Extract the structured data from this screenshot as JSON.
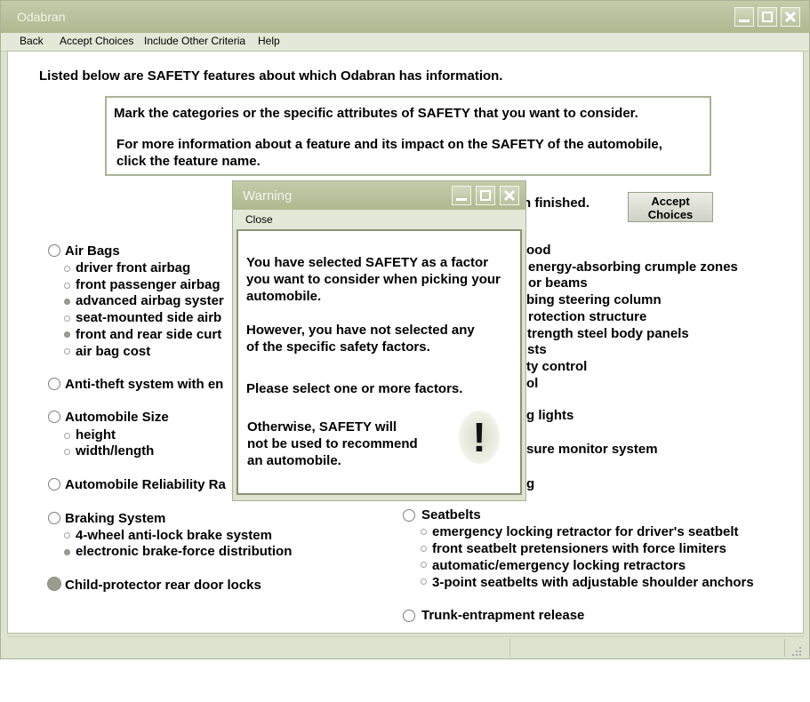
{
  "window": {
    "title": "Odabran"
  },
  "menu": [
    "Back",
    "Accept Choices",
    "Include Other Criteria",
    "Help"
  ],
  "intro": "Listed below are SAFETY features about which Odabran has information.",
  "instructions": {
    "line1": "Mark the categories or the specific attributes of SAFETY that you want to consider.",
    "line2": "For more information about a feature and its impact on the SAFETY of the automobile,",
    "line3": "click the feature name."
  },
  "finished_text": "n finished.",
  "accept_button": {
    "line1": "Accept",
    "line2": "Choices"
  },
  "left_list": {
    "air_bags": {
      "label": "Air Bags",
      "items": [
        {
          "label": "driver front airbag",
          "selected": false
        },
        {
          "label": "front passenger airbag",
          "selected": false
        },
        {
          "label": "advanced airbag syster",
          "selected": true
        },
        {
          "label": "seat-mounted side airb",
          "selected": false
        },
        {
          "label": "front and rear side curt",
          "selected": true
        },
        {
          "label": "air bag cost",
          "selected": false
        }
      ]
    },
    "anti_theft": {
      "label": "Anti-theft system with en"
    },
    "size": {
      "label": "Automobile Size",
      "items": [
        {
          "label": "height",
          "selected": false
        },
        {
          "label": "width/length",
          "selected": false
        }
      ]
    },
    "reliability": {
      "label": "Automobile Reliability Ra"
    },
    "braking": {
      "label": "Braking System",
      "items": [
        {
          "label": "4-wheel anti-lock brake system",
          "selected": false
        },
        {
          "label": "electronic brake-force distribution",
          "selected": true
        }
      ]
    },
    "child_locks": {
      "label": "Child-protector rear door locks",
      "selected": true
    }
  },
  "right_list": {
    "partial": [
      "ood",
      "energy-absorbing crumple zones",
      "or beams",
      "bing steering column",
      "rotection structure",
      "trength steel body panels",
      "sts",
      "ty control",
      "ol",
      "g lights",
      "sure monitor system",
      "g"
    ],
    "seatbelts": {
      "label": "Seatbelts",
      "items": [
        "emergency locking retractor for driver's seatbelt",
        "front seatbelt pretensioners with force limiters",
        "automatic/emergency locking retractors",
        "3-point seatbelts with adjustable shoulder anchors"
      ]
    },
    "trunk": {
      "label": "Trunk-entrapment release"
    }
  },
  "dialog": {
    "title": "Warning",
    "menu_close": "Close",
    "p1": [
      "You have selected SAFETY as a factor",
      "you want to consider when picking your",
      "automobile."
    ],
    "p2": [
      "However, you have not selected any",
      "of the specific safety factors."
    ],
    "p3": "Please select one or more factors.",
    "p4": [
      "Otherwise, SAFETY will",
      "not be used to recommend",
      "an automobile."
    ],
    "icon_glyph": "!"
  }
}
